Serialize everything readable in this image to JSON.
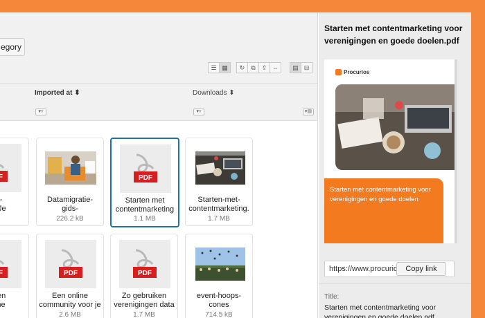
{
  "toolbar": {
    "category_button": "egory"
  },
  "columns": {
    "imported_at": "Imported at",
    "downloads": "Downloads"
  },
  "files": [
    {
      "name_lines": [
        "ios -",
        "er - Je"
      ],
      "size": "kB",
      "type": "pdf"
    },
    {
      "name_lines": [
        "Datamigratie-",
        "gids-"
      ],
      "size": "226.2 kB",
      "type": "photo-office"
    },
    {
      "name_lines": [
        "Starten met",
        "contentmarketing"
      ],
      "size": "1.1 MB",
      "type": "pdf",
      "selected": true
    },
    {
      "name_lines": [
        "Starten-met-",
        "contentmarketing."
      ],
      "size": "1.7 MB",
      "type": "photo-desk"
    },
    {
      "name_lines": [
        "appen",
        "online"
      ],
      "size": "B",
      "type": "pdf"
    },
    {
      "name_lines": [
        "Een online",
        "community voor je"
      ],
      "size": "2.6 MB",
      "type": "pdf"
    },
    {
      "name_lines": [
        "Zo gebruiken",
        "verenigingen data"
      ],
      "size": "1.7 MB",
      "type": "pdf"
    },
    {
      "name_lines": [
        "event-hoops-",
        "cones"
      ],
      "size": "714.5 kB",
      "type": "photo-crowd"
    }
  ],
  "pdf_label": "PDF",
  "detail": {
    "title": "Starten met contentmarketing voor verenigingen en goede doelen.pdf",
    "preview_brand": "Procurios",
    "preview_heading": "Starten met contentmarketing voor verenigingen en goede doelen",
    "link_value": "https://www.procurios.com/",
    "copy_label": "Copy link",
    "meta_label": "Title:",
    "meta_value": "Starten met contentmarketing voor verenigingen en goede doelen.pdf"
  },
  "colors": {
    "accent": "#f4873a",
    "selected_border": "#1f6fa8",
    "pdf_red": "#d42020"
  }
}
